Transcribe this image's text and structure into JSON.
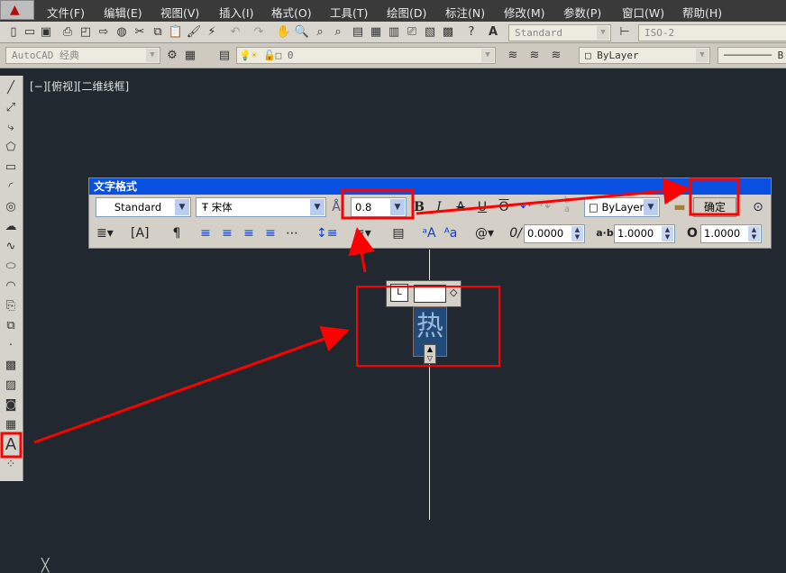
{
  "menu": [
    "文件(F)",
    "编辑(E)",
    "视图(V)",
    "插入(I)",
    "格式(O)",
    "工具(T)",
    "绘图(D)",
    "标注(N)",
    "修改(M)",
    "参数(P)",
    "窗口(W)",
    "帮助(H)"
  ],
  "toolbar": {
    "text_style": "Standard",
    "dim_style": "ISO-2",
    "workspace": "AutoCAD 经典",
    "layer": "0",
    "color": "ByLayer",
    "linetype": "B"
  },
  "viewport_label": "[−][俯视][二维线框]",
  "text_format": {
    "title": "文字格式",
    "style": "Standard",
    "font": "宋体",
    "height": "0.8",
    "color": "ByLayer",
    "ok": "确定",
    "oblique": "0.0000",
    "tracking": "1.0000",
    "width_factor": "1.0000"
  },
  "mtext": {
    "content": "热"
  },
  "annotation_color": "#ff0000"
}
